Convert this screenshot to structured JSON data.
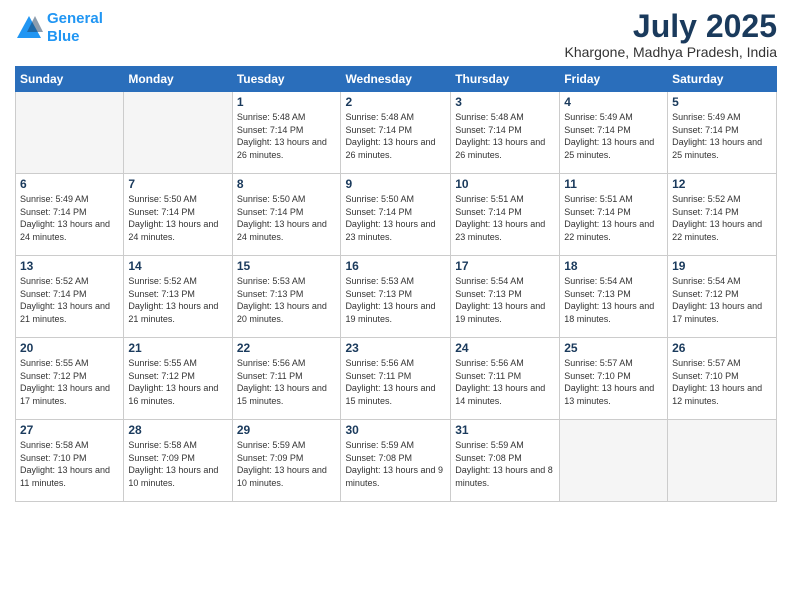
{
  "header": {
    "logo_line1": "General",
    "logo_line2": "Blue",
    "month": "July 2025",
    "location": "Khargone, Madhya Pradesh, India"
  },
  "days_of_week": [
    "Sunday",
    "Monday",
    "Tuesday",
    "Wednesday",
    "Thursday",
    "Friday",
    "Saturday"
  ],
  "weeks": [
    [
      {
        "num": "",
        "sunrise": "",
        "sunset": "",
        "daylight": "",
        "empty": true
      },
      {
        "num": "",
        "sunrise": "",
        "sunset": "",
        "daylight": "",
        "empty": true
      },
      {
        "num": "1",
        "sunrise": "Sunrise: 5:48 AM",
        "sunset": "Sunset: 7:14 PM",
        "daylight": "Daylight: 13 hours and 26 minutes."
      },
      {
        "num": "2",
        "sunrise": "Sunrise: 5:48 AM",
        "sunset": "Sunset: 7:14 PM",
        "daylight": "Daylight: 13 hours and 26 minutes."
      },
      {
        "num": "3",
        "sunrise": "Sunrise: 5:48 AM",
        "sunset": "Sunset: 7:14 PM",
        "daylight": "Daylight: 13 hours and 26 minutes."
      },
      {
        "num": "4",
        "sunrise": "Sunrise: 5:49 AM",
        "sunset": "Sunset: 7:14 PM",
        "daylight": "Daylight: 13 hours and 25 minutes."
      },
      {
        "num": "5",
        "sunrise": "Sunrise: 5:49 AM",
        "sunset": "Sunset: 7:14 PM",
        "daylight": "Daylight: 13 hours and 25 minutes."
      }
    ],
    [
      {
        "num": "6",
        "sunrise": "Sunrise: 5:49 AM",
        "sunset": "Sunset: 7:14 PM",
        "daylight": "Daylight: 13 hours and 24 minutes."
      },
      {
        "num": "7",
        "sunrise": "Sunrise: 5:50 AM",
        "sunset": "Sunset: 7:14 PM",
        "daylight": "Daylight: 13 hours and 24 minutes."
      },
      {
        "num": "8",
        "sunrise": "Sunrise: 5:50 AM",
        "sunset": "Sunset: 7:14 PM",
        "daylight": "Daylight: 13 hours and 24 minutes."
      },
      {
        "num": "9",
        "sunrise": "Sunrise: 5:50 AM",
        "sunset": "Sunset: 7:14 PM",
        "daylight": "Daylight: 13 hours and 23 minutes."
      },
      {
        "num": "10",
        "sunrise": "Sunrise: 5:51 AM",
        "sunset": "Sunset: 7:14 PM",
        "daylight": "Daylight: 13 hours and 23 minutes."
      },
      {
        "num": "11",
        "sunrise": "Sunrise: 5:51 AM",
        "sunset": "Sunset: 7:14 PM",
        "daylight": "Daylight: 13 hours and 22 minutes."
      },
      {
        "num": "12",
        "sunrise": "Sunrise: 5:52 AM",
        "sunset": "Sunset: 7:14 PM",
        "daylight": "Daylight: 13 hours and 22 minutes."
      }
    ],
    [
      {
        "num": "13",
        "sunrise": "Sunrise: 5:52 AM",
        "sunset": "Sunset: 7:14 PM",
        "daylight": "Daylight: 13 hours and 21 minutes."
      },
      {
        "num": "14",
        "sunrise": "Sunrise: 5:52 AM",
        "sunset": "Sunset: 7:13 PM",
        "daylight": "Daylight: 13 hours and 21 minutes."
      },
      {
        "num": "15",
        "sunrise": "Sunrise: 5:53 AM",
        "sunset": "Sunset: 7:13 PM",
        "daylight": "Daylight: 13 hours and 20 minutes."
      },
      {
        "num": "16",
        "sunrise": "Sunrise: 5:53 AM",
        "sunset": "Sunset: 7:13 PM",
        "daylight": "Daylight: 13 hours and 19 minutes."
      },
      {
        "num": "17",
        "sunrise": "Sunrise: 5:54 AM",
        "sunset": "Sunset: 7:13 PM",
        "daylight": "Daylight: 13 hours and 19 minutes."
      },
      {
        "num": "18",
        "sunrise": "Sunrise: 5:54 AM",
        "sunset": "Sunset: 7:13 PM",
        "daylight": "Daylight: 13 hours and 18 minutes."
      },
      {
        "num": "19",
        "sunrise": "Sunrise: 5:54 AM",
        "sunset": "Sunset: 7:12 PM",
        "daylight": "Daylight: 13 hours and 17 minutes."
      }
    ],
    [
      {
        "num": "20",
        "sunrise": "Sunrise: 5:55 AM",
        "sunset": "Sunset: 7:12 PM",
        "daylight": "Daylight: 13 hours and 17 minutes."
      },
      {
        "num": "21",
        "sunrise": "Sunrise: 5:55 AM",
        "sunset": "Sunset: 7:12 PM",
        "daylight": "Daylight: 13 hours and 16 minutes."
      },
      {
        "num": "22",
        "sunrise": "Sunrise: 5:56 AM",
        "sunset": "Sunset: 7:11 PM",
        "daylight": "Daylight: 13 hours and 15 minutes."
      },
      {
        "num": "23",
        "sunrise": "Sunrise: 5:56 AM",
        "sunset": "Sunset: 7:11 PM",
        "daylight": "Daylight: 13 hours and 15 minutes."
      },
      {
        "num": "24",
        "sunrise": "Sunrise: 5:56 AM",
        "sunset": "Sunset: 7:11 PM",
        "daylight": "Daylight: 13 hours and 14 minutes."
      },
      {
        "num": "25",
        "sunrise": "Sunrise: 5:57 AM",
        "sunset": "Sunset: 7:10 PM",
        "daylight": "Daylight: 13 hours and 13 minutes."
      },
      {
        "num": "26",
        "sunrise": "Sunrise: 5:57 AM",
        "sunset": "Sunset: 7:10 PM",
        "daylight": "Daylight: 13 hours and 12 minutes."
      }
    ],
    [
      {
        "num": "27",
        "sunrise": "Sunrise: 5:58 AM",
        "sunset": "Sunset: 7:10 PM",
        "daylight": "Daylight: 13 hours and 11 minutes."
      },
      {
        "num": "28",
        "sunrise": "Sunrise: 5:58 AM",
        "sunset": "Sunset: 7:09 PM",
        "daylight": "Daylight: 13 hours and 10 minutes."
      },
      {
        "num": "29",
        "sunrise": "Sunrise: 5:59 AM",
        "sunset": "Sunset: 7:09 PM",
        "daylight": "Daylight: 13 hours and 10 minutes."
      },
      {
        "num": "30",
        "sunrise": "Sunrise: 5:59 AM",
        "sunset": "Sunset: 7:08 PM",
        "daylight": "Daylight: 13 hours and 9 minutes."
      },
      {
        "num": "31",
        "sunrise": "Sunrise: 5:59 AM",
        "sunset": "Sunset: 7:08 PM",
        "daylight": "Daylight: 13 hours and 8 minutes."
      },
      {
        "num": "",
        "sunrise": "",
        "sunset": "",
        "daylight": "",
        "empty": true
      },
      {
        "num": "",
        "sunrise": "",
        "sunset": "",
        "daylight": "",
        "empty": true
      }
    ]
  ]
}
